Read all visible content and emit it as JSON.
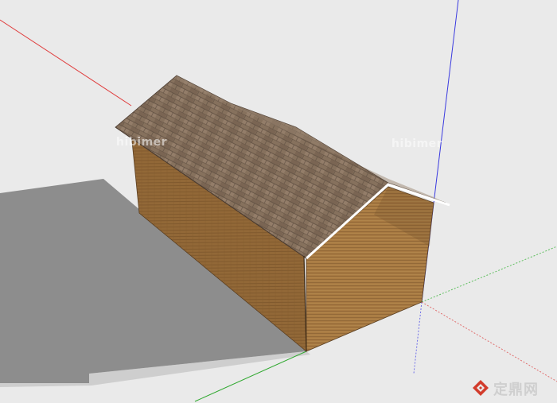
{
  "watermarks": {
    "left": "hibimer",
    "right": "hibimer"
  },
  "brand": {
    "name": "定鼎网",
    "logo_icon": "dingding-logo-icon",
    "logo_color": "#d23c2c"
  },
  "scene": {
    "background_color": "#eaeaea",
    "ground_shadow_color": "#8c8c8c",
    "roof_color": "#85705d",
    "wall_color": "#a87a42",
    "axes": {
      "red_axis_color": "#e04040",
      "green_axis_color": "#2fa82f",
      "blue_axis_color": "#3a3ae0"
    }
  }
}
